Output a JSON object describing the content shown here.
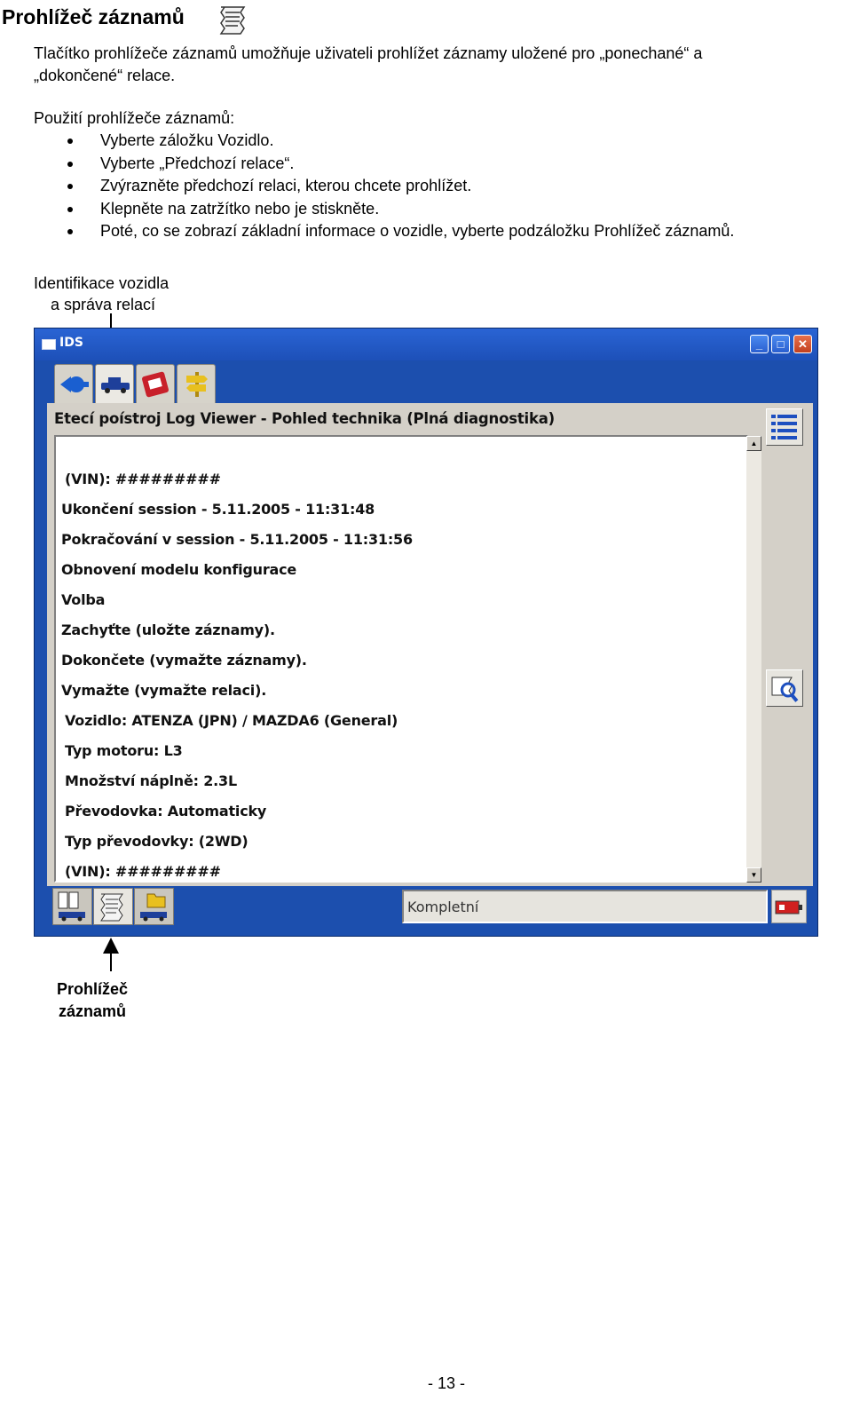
{
  "heading": "Prohlížeč záznamů",
  "intro": [
    "Tlačítko prohlížeče záznamů umožňuje uživateli prohlížet záznamy uložené pro „ponechané“ a",
    "„dokončené“ relace."
  ],
  "usage_label": "Použití prohlížeče záznamů:",
  "steps": [
    "Vyberte záložku Vozidlo.",
    "Vyberte „Předchozí relace“.",
    "Zvýrazněte předchozí relaci, kterou chcete prohlížet.",
    "Klepněte na zatržítko nebo je stiskněte.",
    "Poté, co se zobrazí základní informace o vozidle, vyberte podzáložku Prohlížeč záznamů."
  ],
  "callout_top": [
    "Identifikace vozidla",
    "a správa relací"
  ],
  "callout_bottom": [
    "Prohlížeč",
    "záznamů"
  ],
  "window": {
    "title": "IDS",
    "panel_title": "Etecí poístroj Log Viewer - Pohled technika (Plná diagnostika)",
    "log_lines": [
      "(VIN):  #########",
      "Ukončení session - 5.11.2005 - 11:31:48",
      "Pokračování v session - 5.11.2005 - 11:31:56",
      "Obnovení modelu konfigurace",
      "Volba",
      "Zachyťte (uložte záznamy).",
      "Dokončete (vymažte záznamy).",
      "Vymažte (vymažte relaci).",
      "Vozidlo:  ATENZA (JPN) / MAZDA6 (General)",
      "Typ motoru:  L3",
      "Množství náplně:  2.3L",
      "Převodovka:  Automaticky",
      "Typ převodovky:  (2WD)",
      "(VIN):  #########"
    ],
    "status_text": "Kompletní"
  },
  "page_number": "- 13 -",
  "colors": {
    "window_blue": "#1c4fae",
    "panel_gray": "#d4d0c8"
  }
}
